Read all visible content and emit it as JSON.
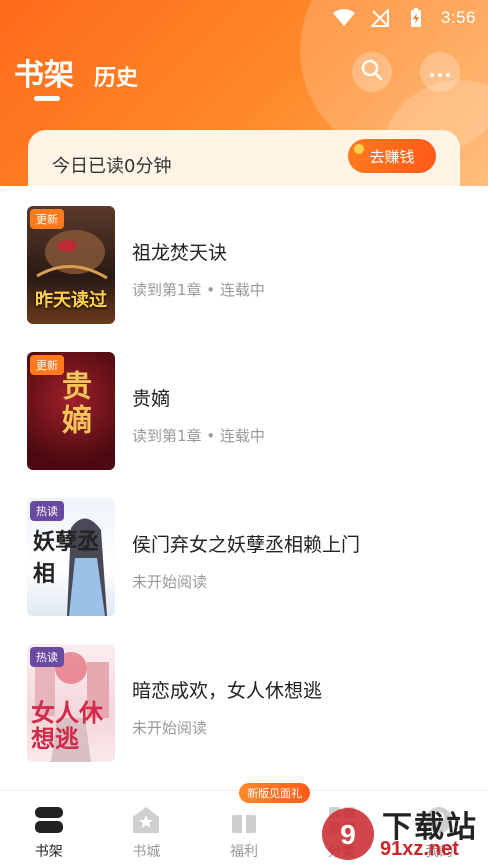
{
  "status_bar": {
    "time": "3:56"
  },
  "header": {
    "tabs": [
      {
        "label": "书架",
        "active": true
      },
      {
        "label": "历史",
        "active": false
      }
    ],
    "read_banner": {
      "text": "今日已读0分钟",
      "button_label": "去赚钱"
    }
  },
  "books": [
    {
      "title": "祖龙焚天诀",
      "progress": "读到第1章 • 连载中",
      "badge": "更新",
      "cover_caption": "昨天读过"
    },
    {
      "title": "贵嫡",
      "progress": "读到第1章 • 连载中",
      "badge": "更新",
      "cover_text": "贵嫡"
    },
    {
      "title": "侯门弃女之妖孽丞相赖上门",
      "progress": "未开始阅读",
      "badge": "热读",
      "cover_text": "妖孽丞相"
    },
    {
      "title": "暗恋成欢，女人休想逃",
      "progress": "未开始阅读",
      "badge": "热读",
      "cover_text": "女人休想逃"
    }
  ],
  "bottom_nav": {
    "items": [
      {
        "label": "书架",
        "active": true
      },
      {
        "label": "书城",
        "active": false
      },
      {
        "label": "福利",
        "active": false,
        "tag": "新版见面礼"
      },
      {
        "label": "分类",
        "active": false
      },
      {
        "label": "我的",
        "active": false
      }
    ]
  },
  "watermark": {
    "line1": "下载站",
    "line2": "91xz.net"
  },
  "colors": {
    "accent": "#ff6a1a",
    "banner_bg": "#fff4e6",
    "badge_update": "#ff7a1c",
    "badge_hot": "#6a4aa0"
  }
}
